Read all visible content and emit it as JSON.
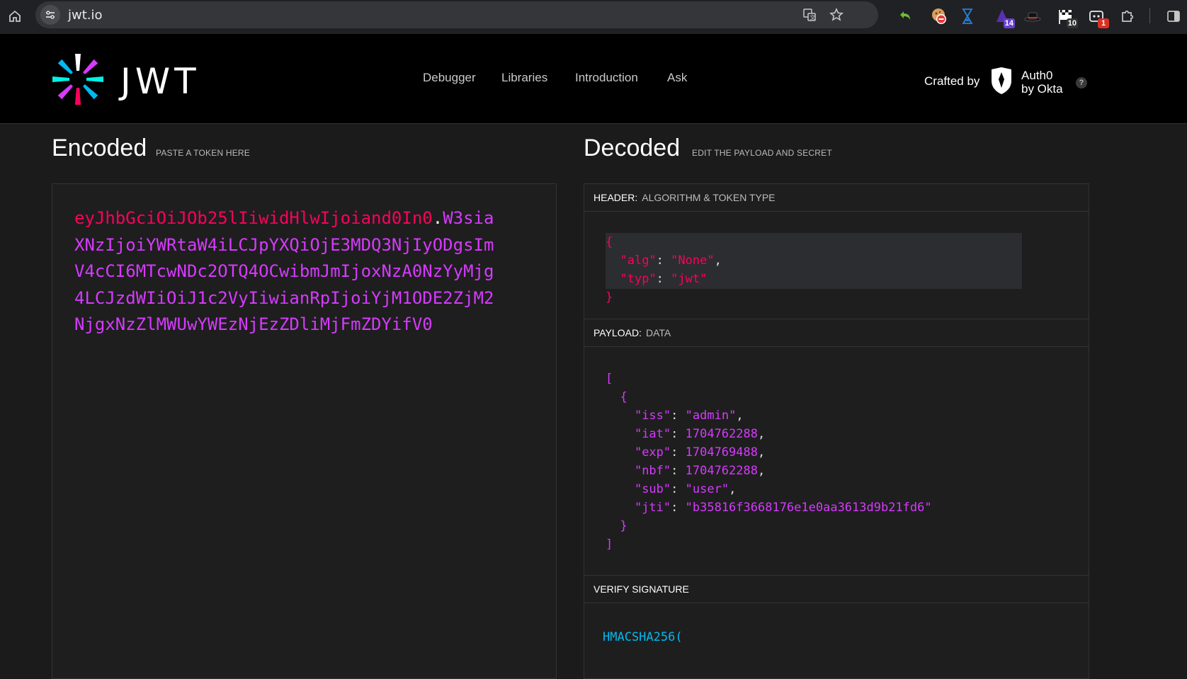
{
  "browser": {
    "url": "jwt.io",
    "extensions": [
      {
        "name": "translate-icon"
      },
      {
        "name": "bookmark-star-icon"
      },
      {
        "name": "undo-arrow-icon"
      },
      {
        "name": "cookie-extension-icon"
      },
      {
        "name": "hourglass-extension-icon"
      },
      {
        "name": "wizard-hat-extension-icon",
        "badge": "14",
        "badge_color": "#6b3fd1"
      },
      {
        "name": "hat-extension-icon"
      },
      {
        "name": "flag-extension-icon",
        "badge": "10",
        "badge_color": "#333333"
      },
      {
        "name": "bot-extension-icon",
        "badge": "1",
        "badge_color": "#d93025"
      },
      {
        "name": "puzzle-extensions-icon"
      },
      {
        "name": "side-panel-icon"
      }
    ]
  },
  "header": {
    "logo_text": "JWT",
    "nav": [
      "Debugger",
      "Libraries",
      "Introduction",
      "Ask"
    ],
    "crafted_by": "Crafted by",
    "auth0_line1": "Auth0",
    "auth0_line2": "by Okta",
    "help": "?"
  },
  "encoded": {
    "title": "Encoded",
    "subtitle": "PASTE A TOKEN HERE",
    "token_header": "eyJhbGciOiJOb25lIiwidHlwIjoiand0In0",
    "token_dot": ".",
    "token_payload": "W3siaXNzIjoiYWRtaW4iLCJpYXQiOjE3MDQ3NjIyODgsImV4cCI6MTcwNDc2OTQ4OCwibmJmIjoxNzA0NzYyMjg4LCJzdWIiOiJ1c2VyIiwianRpIjoiYjM1ODE2ZjM2NjgxNzZlMWUwYWEzNjEzZDliMjFmZDYifV0"
  },
  "decoded": {
    "title": "Decoded",
    "subtitle": "EDIT THE PAYLOAD AND SECRET",
    "header_section": {
      "label": "HEADER:",
      "sub": "ALGORITHM & TOKEN TYPE"
    },
    "header_json": {
      "alg": "None",
      "typ": "jwt"
    },
    "payload_section": {
      "label": "PAYLOAD:",
      "sub": "DATA"
    },
    "payload_json": {
      "iss": "admin",
      "iat": 1704762288,
      "exp": 1704769488,
      "nbf": 1704762288,
      "sub": "user",
      "jti": "b35816f3668176e1e0aa3613d9b21fd6"
    },
    "verify_section": {
      "label": "VERIFY SIGNATURE"
    },
    "verify_code": "HMACSHA256("
  }
}
